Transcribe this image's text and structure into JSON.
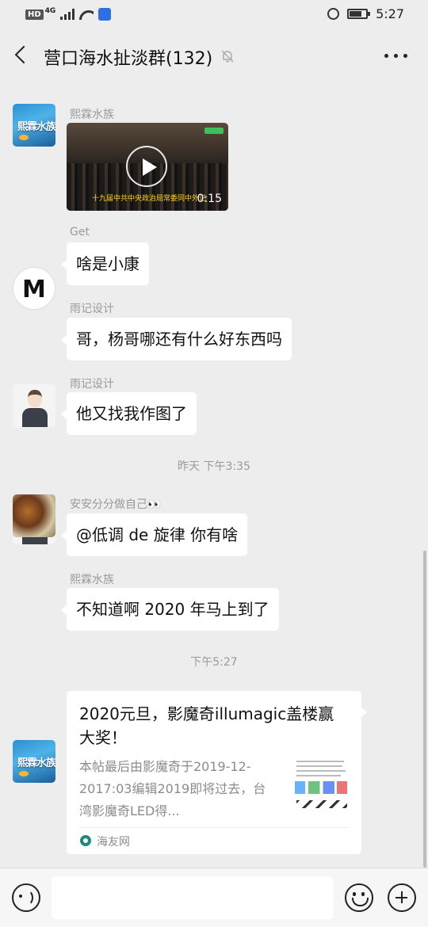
{
  "status_bar": {
    "hd_badge": "HD",
    "network": "4G",
    "time": "5:27"
  },
  "header": {
    "title": "营口海水扯淡群(132)"
  },
  "messages": [
    {
      "sender": "熙霖水族",
      "type": "video",
      "video_caption": "十九届中共中央政治局常委同中外记",
      "duration": "0:15"
    },
    {
      "sender": "Get",
      "type": "text",
      "text": "啥是小康"
    },
    {
      "sender": "雨记设计",
      "type": "text",
      "text": "哥，杨哥哪还有什么好东西吗"
    },
    {
      "sender": "雨记设计",
      "type": "text",
      "text": "他又找我作图了"
    },
    {
      "sender": "安安分分做自己👀",
      "type": "text",
      "text": "@低调 de 旋律  你有啥"
    },
    {
      "sender": "熙霖水族",
      "type": "text",
      "text": "不知道啊 2020 年马上到了"
    }
  ],
  "timestamps": [
    "昨天 下午3:35",
    "下午5:27"
  ],
  "link_card": {
    "title": "2020元旦，影魔奇illumagic盖楼赢大奖！",
    "description": "本帖最后由影魔奇于2019-12-2017:03编辑2019即将过去，台湾影魔奇LED得...",
    "source": "海友网"
  },
  "input": {
    "placeholder": ""
  },
  "avatars": {
    "lake_label": "熙霖水族"
  },
  "colors": {
    "background": "#ededed",
    "bubble": "#ffffff",
    "meta_text": "#9a9a9a"
  }
}
